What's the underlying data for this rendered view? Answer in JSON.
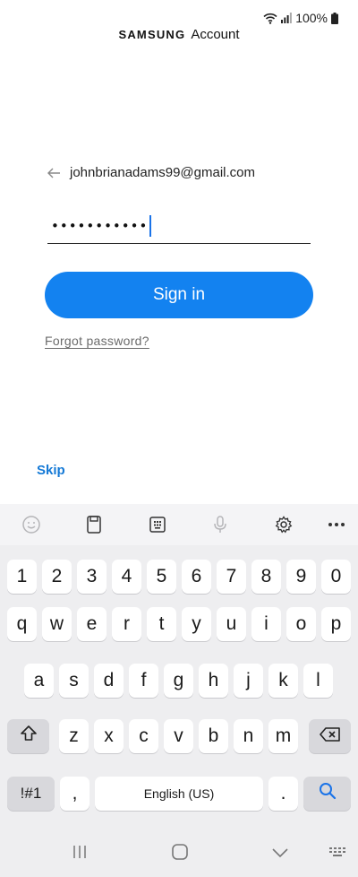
{
  "status": {
    "battery": "100%"
  },
  "header": {
    "brand": "SAMSUNG",
    "title": "Account"
  },
  "login": {
    "email": "johnbrianadams99@gmail.com",
    "password_mask": "•••••••••••",
    "signin_label": "Sign in",
    "forgot_label": "Forgot password?",
    "skip_label": "Skip"
  },
  "keyboard": {
    "numbers": [
      "1",
      "2",
      "3",
      "4",
      "5",
      "6",
      "7",
      "8",
      "9",
      "0"
    ],
    "row1": [
      "q",
      "w",
      "e",
      "r",
      "t",
      "y",
      "u",
      "i",
      "o",
      "p"
    ],
    "row2": [
      "a",
      "s",
      "d",
      "f",
      "g",
      "h",
      "j",
      "k",
      "l"
    ],
    "row3": [
      "z",
      "x",
      "c",
      "v",
      "b",
      "n",
      "m"
    ],
    "symbols_label": "!#1",
    "comma": ",",
    "space_label": "English (US)",
    "period": "."
  },
  "colors": {
    "accent": "#1382f0",
    "link": "#1479d6",
    "keyboard_bg": "#eeeef0"
  }
}
